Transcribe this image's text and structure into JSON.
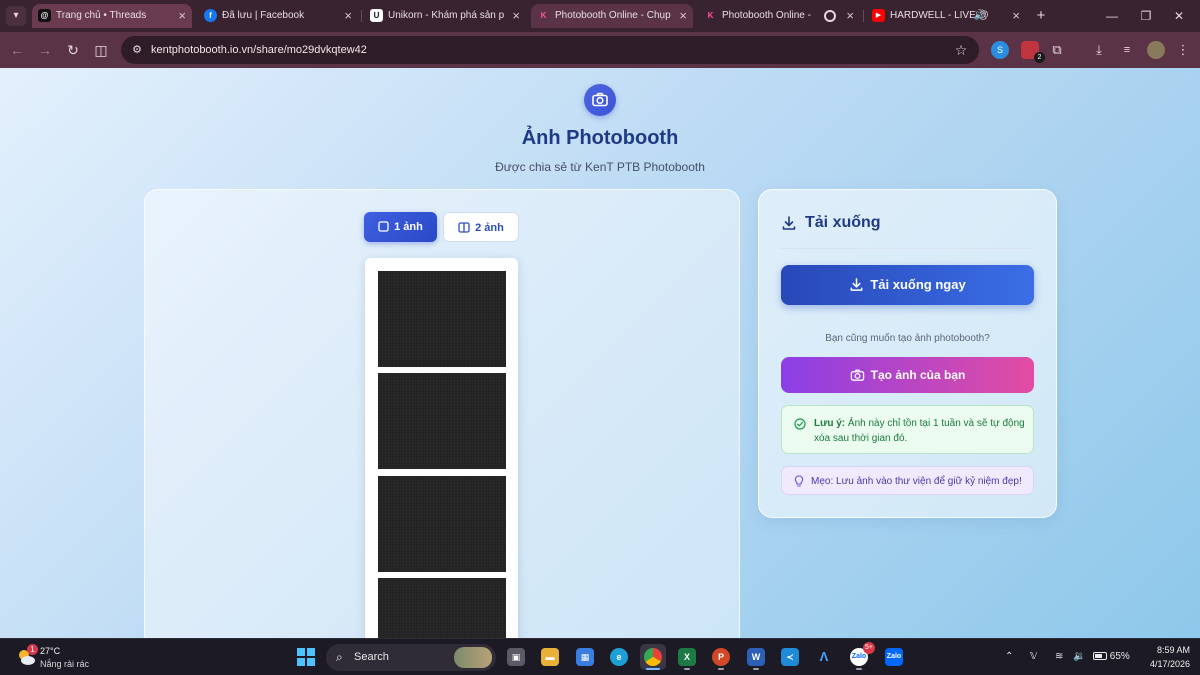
{
  "browser": {
    "tabs": [
      {
        "title": "Trang chủ • Threads",
        "favicon": "threads-icon",
        "active": false
      },
      {
        "title": "Đã lưu | Facebook",
        "favicon": "facebook-icon",
        "active": false
      },
      {
        "title": "Unikorn - Khám phá sản ph",
        "favicon": "unikorn-icon",
        "active": false
      },
      {
        "title": "Photobooth Online - Chụp",
        "favicon": "kent-icon",
        "active": true
      },
      {
        "title": "Photobooth Online - C",
        "favicon": "kent-icon",
        "active": false
      },
      {
        "title": "HARDWELL - LIVE @ U",
        "favicon": "youtube-icon",
        "active": false
      }
    ],
    "url": "kentphotobooth.io.vn/share/mo29dvkqtew42",
    "extension_badge": "2"
  },
  "page": {
    "title": "Ảnh Photobooth",
    "subtitle": "Được chia sẻ từ KenT PTB Photobooth",
    "layout_options": [
      {
        "label": "1 ảnh",
        "selected": true
      },
      {
        "label": "2 ảnh",
        "selected": false
      }
    ],
    "photo_frames": 4
  },
  "download_panel": {
    "heading": "Tải xuống",
    "download_button": "Tải xuống ngay",
    "prompt": "Bạn cũng muốn tạo ảnh photobooth?",
    "create_button": "Tạo ảnh của bạn",
    "note_label": "Lưu ý:",
    "note_text": " Ảnh này chỉ tồn tại 1 tuần và sẽ tự động xóa sau thời gian đó.",
    "tip_text": "Mẹo: Lưu ảnh vào thư viện để giữ kỷ niệm đẹp!"
  },
  "taskbar": {
    "weather_temp": "27°C",
    "weather_desc": "Nắng rải rác",
    "weather_badge": "1",
    "search_label": "Search",
    "zalo_badge": "5+",
    "battery": "65%",
    "time": "8:59 AM",
    "date": "4/17/2026"
  },
  "colors": {
    "accent_blue": "#2848b8",
    "create_gradient_start": "#8b3fe6",
    "create_gradient_end": "#e34ca3",
    "note_green": "#1c7a3f",
    "tip_purple": "#4a3aa6"
  }
}
